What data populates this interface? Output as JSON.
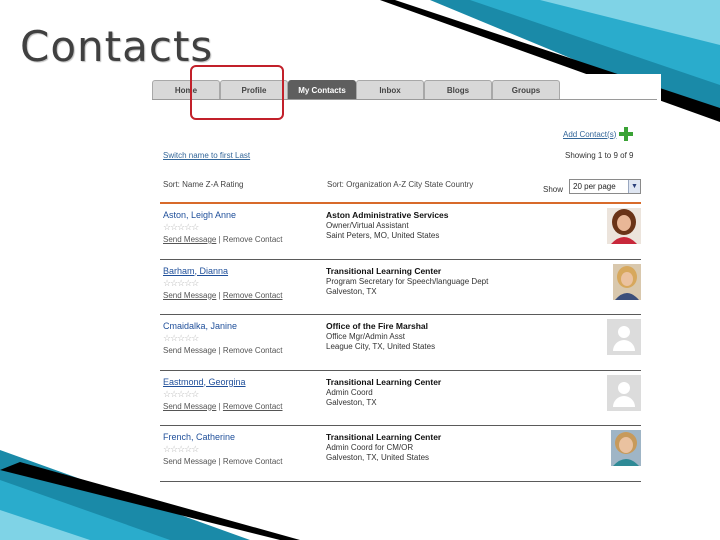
{
  "slide": {
    "title": "Contacts"
  },
  "tabs": [
    "Home",
    "Profile",
    "My Contacts",
    "Inbox",
    "Blogs",
    "Groups"
  ],
  "toolbar": {
    "add_contact": "Add Contact(s)",
    "switch_name": "Switch name to first Last",
    "showing": "Showing 1 to 9 of 9",
    "sort_name": "Sort: Name Z-A Rating",
    "sort_org": "Sort: Organization A-Z City State Country",
    "show_label": "Show",
    "per_page": "20 per page"
  },
  "colors": {
    "accent_line": "#d86a2a",
    "highlight": "#c2202a",
    "link": "#1f4f9a",
    "add_icon": "#3aa335"
  },
  "contacts": [
    {
      "name": "Aston, Leigh Anne",
      "rating": "☆☆☆☆☆",
      "send": "Send Message",
      "sep": "|",
      "remove": "Remove Contact",
      "org": "Aston Administrative Services",
      "role": "Owner/Virtual Assistant",
      "location": "Saint Peters, MO, United States",
      "photo": "photo"
    },
    {
      "name": "Barham, Dianna",
      "rating": "☆☆☆☆☆",
      "send": "Send Message",
      "sep": "|",
      "remove": "Remove Contact",
      "org": "Transitional Learning Center",
      "role": "Program Secretary for Speech/language Dept",
      "location": "Galveston, TX",
      "photo": "photo"
    },
    {
      "name": "Cmaidalka, Janine",
      "rating": "☆☆☆☆☆",
      "send": "Send Message",
      "sep": "|",
      "remove": "Remove Contact",
      "org": "Office of the Fire Marshal",
      "role": "Office Mgr/Admin Asst",
      "location": "League City, TX, United States",
      "photo": "placeholder"
    },
    {
      "name": "Eastmond, Georgina",
      "rating": "☆☆☆☆☆",
      "send": "Send Message",
      "sep": "|",
      "remove": "Remove Contact",
      "org": "Transitional Learning Center",
      "role": "Admin Coord",
      "location": "Galveston, TX",
      "photo": "placeholder"
    },
    {
      "name": "French, Catherine",
      "rating": "☆☆☆☆☆",
      "send": "Send Message",
      "sep": "|",
      "remove": "Remove Contact",
      "org": "Transitional Learning Center",
      "role": "Admin Coord for CM/OR",
      "location": "Galveston, TX, United States",
      "photo": "photo"
    }
  ]
}
